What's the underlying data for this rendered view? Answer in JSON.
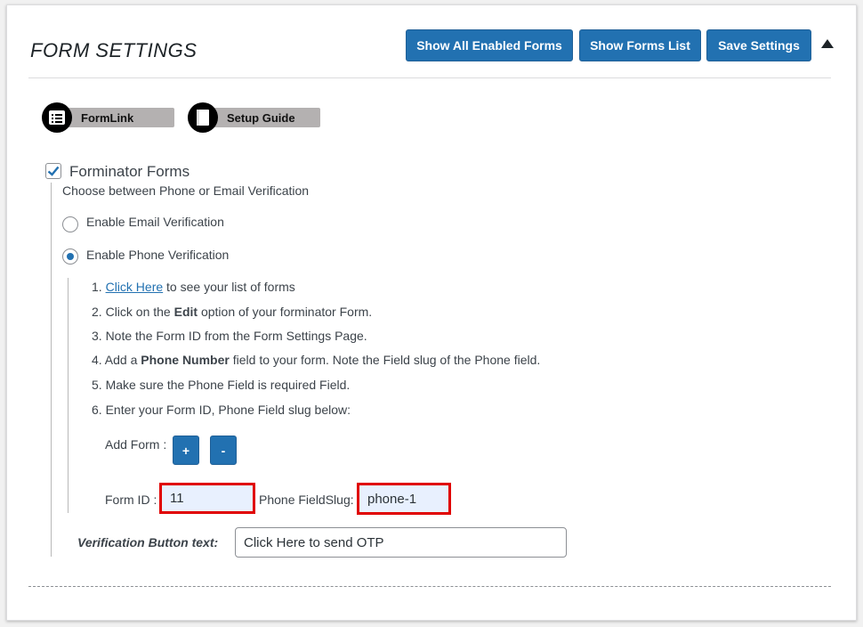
{
  "header": {
    "title": "FORM SETTINGS",
    "buttons": {
      "show_all_enabled": "Show All Enabled Forms",
      "show_forms_list": "Show Forms List",
      "save_settings": "Save Settings"
    },
    "collapse_icon": "triangle-up-icon"
  },
  "links": {
    "formlink": {
      "label": "FormLink",
      "icon": "form-list-icon"
    },
    "setup_guide": {
      "label": "Setup Guide",
      "icon": "book-icon"
    }
  },
  "section": {
    "title": "Forminator Forms",
    "checked": true,
    "description": "Choose between Phone or Email Verification",
    "radio_email": "Enable Email Verification",
    "radio_phone": "Enable Phone Verification",
    "selected": "phone"
  },
  "steps": {
    "s1_num": "1.",
    "s1_link": "Click Here",
    "s1_rest": " to see your list of forms",
    "s2_num": "2.",
    "s2_pre": "Click on the ",
    "s2_bold": "Edit",
    "s2_post": " option of your forminator Form.",
    "s3": "3. Note the Form ID from the Form Settings Page.",
    "s4_pre": "4. Add a ",
    "s4_bold": "Phone Number",
    "s4_post": " field to your form. Note the Field slug of the Phone field.",
    "s5": "5. Make sure the Phone Field is required Field.",
    "s6": "6. Enter your Form ID, Phone Field slug below:"
  },
  "form_fields": {
    "add_form_label": "Add Form :",
    "add_button": "+",
    "remove_button": "-",
    "form_id_label": "Form ID :",
    "form_id_value": "11",
    "phone_slug_label": "Phone FieldSlug:",
    "phone_slug_value": "phone-1",
    "highlight_color": "#e00000"
  },
  "verification": {
    "label": "Verification Button text:",
    "value": "Click Here to send OTP"
  },
  "colors": {
    "primary": "#2271b1",
    "text": "#3c434a",
    "pill": "#b4b1b1"
  }
}
